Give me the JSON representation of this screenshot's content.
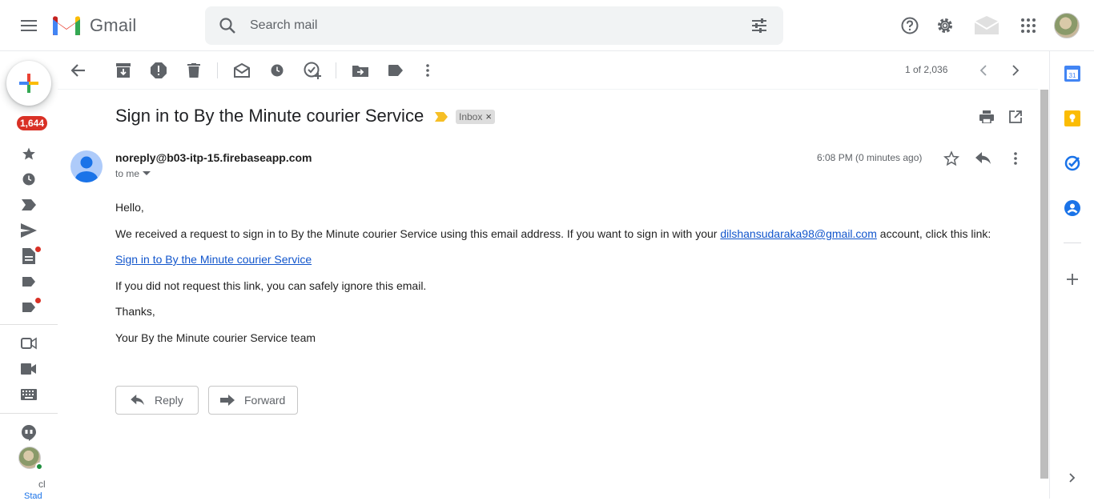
{
  "header": {
    "app_name": "Gmail",
    "search_placeholder": "Search mail"
  },
  "rail": {
    "unread_badge": "1,644",
    "fragment_1": "cl",
    "fragment_2": "Stad"
  },
  "toolbar": {
    "page_count": "1 of 2,036"
  },
  "message": {
    "subject": "Sign in to By the Minute courier Service",
    "label_chip": "Inbox",
    "label_remove": "×",
    "sender": "noreply@b03-itp-15.firebaseapp.com",
    "recipient": "to me",
    "time": "6:08 PM (0 minutes ago)",
    "body": {
      "greeting": "Hello,",
      "line1_prefix": "We received a request to sign in to By the Minute courier Service using this email address. If you want to sign in with your ",
      "line1_email": "dilshansudaraka98@gmail.com",
      "line1_suffix": " account, click this link:",
      "signin_link": "Sign in to By the Minute courier Service",
      "ignore_line": "If you did not request this link, you can safely ignore this email.",
      "thanks": "Thanks,",
      "signature": "Your By the Minute courier Service team"
    },
    "reply_label": "Reply",
    "forward_label": "Forward"
  },
  "colors": {
    "brand_red": "#d93025",
    "link_blue": "#1155cc",
    "importance_yellow": "#f6bf26"
  }
}
